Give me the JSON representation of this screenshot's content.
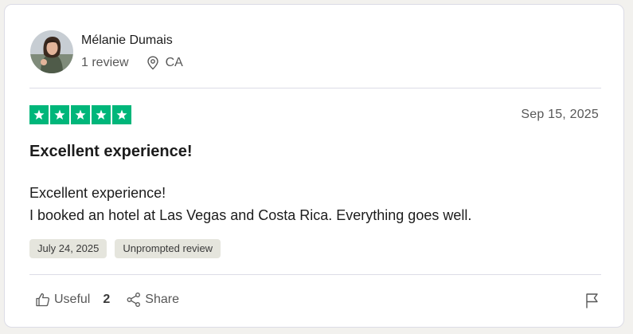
{
  "reviewer": {
    "name": "Mélanie Dumais",
    "review_count": "1 review",
    "location": "CA"
  },
  "review": {
    "rating": 5,
    "date": "Sep 15, 2025",
    "title": "Excellent experience!",
    "body_lines": [
      "Excellent experience!",
      "I booked an hotel at Las Vegas and Costa Rica. Everything goes well."
    ],
    "tags": [
      "July 24, 2025",
      "Unprompted review"
    ]
  },
  "actions": {
    "useful_label": "Useful",
    "useful_count": "2",
    "share_label": "Share"
  },
  "colors": {
    "star_green": "#00b67a",
    "tag_bg": "#e5e5dd",
    "divider": "#dcdce6"
  },
  "icons": {
    "location": "location-pin-icon",
    "useful": "thumbs-up-icon",
    "share": "share-icon",
    "flag": "flag-icon"
  }
}
